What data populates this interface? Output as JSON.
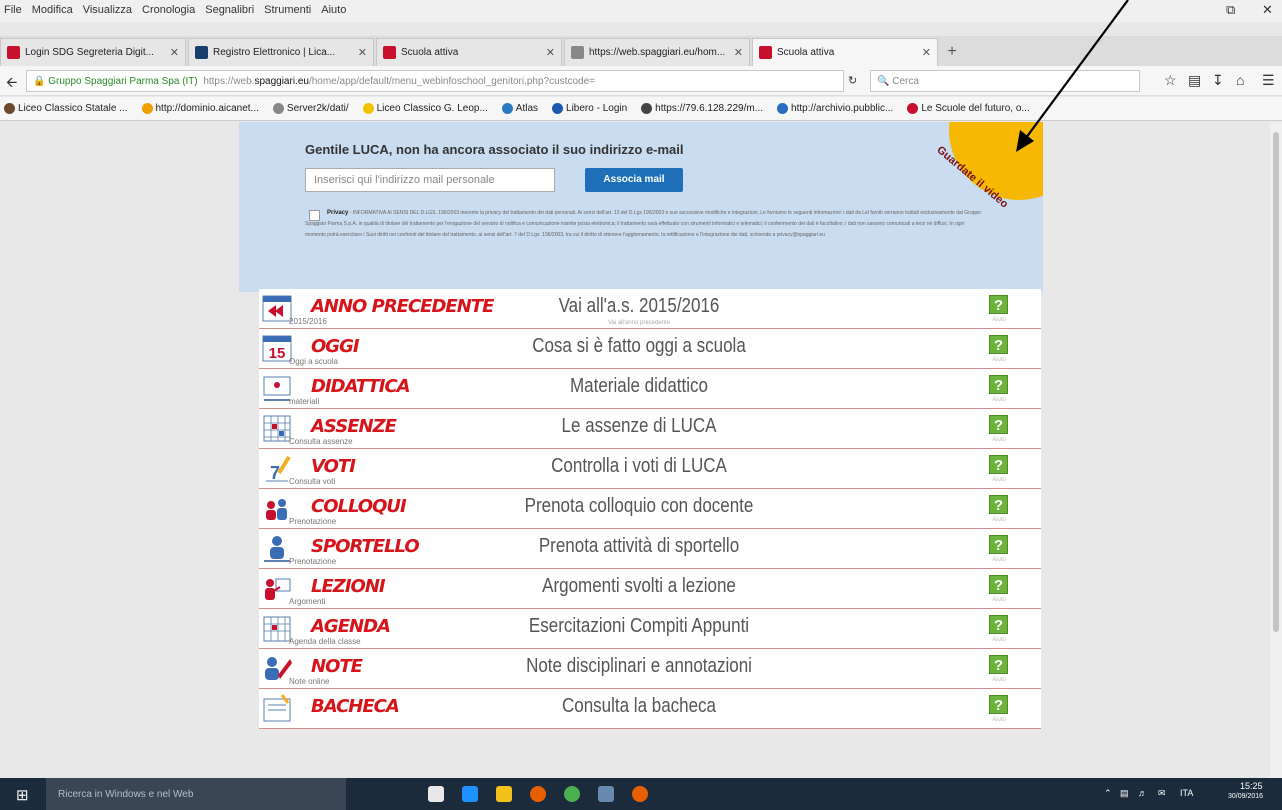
{
  "window_menu": [
    "File",
    "Modifica",
    "Visualizza",
    "Cronologia",
    "Segnalibri",
    "Strumenti",
    "Aiuto"
  ],
  "tabs": [
    {
      "label": "Login SDG Segreteria Digit...",
      "color": "#c8102e"
    },
    {
      "label": "Registro Elettronico | Lica...",
      "color": "#1a3c6e"
    },
    {
      "label": "Scuola attiva",
      "color": "#c8102e"
    },
    {
      "label": "https://web.spaggiari.eu/hom...",
      "color": "#888888"
    },
    {
      "label": "Scuola attiva",
      "color": "#c8102e"
    }
  ],
  "address": {
    "site": "Gruppo Spaggiari Parma Spa (IT)",
    "prefix": "https://web.",
    "domain": "spaggiari.eu",
    "path": "/home/app/default/menu_webinfoschool_genitori.php?custcode="
  },
  "search": {
    "placeholder": "Cerca"
  },
  "bookmarks": [
    {
      "label": "Liceo Classico Statale ...",
      "color": "#6a4a2a"
    },
    {
      "label": "http://dominio.aicanet...",
      "color": "#f0a000"
    },
    {
      "label": "Server2k/dati/",
      "color": "#888888"
    },
    {
      "label": "Liceo Classico G. Leop...",
      "color": "#f2c200"
    },
    {
      "label": "Atlas",
      "color": "#2a7ac0"
    },
    {
      "label": "Libero - Login",
      "color": "#1a5ab0"
    },
    {
      "label": "https://79.6.128.229/m...",
      "color": "#444444"
    },
    {
      "label": "http://archivio.pubblic...",
      "color": "#2a6ac0"
    },
    {
      "label": "Le Scuole del futuro, o...",
      "color": "#c8102e"
    }
  ],
  "panel": {
    "title": "Gentile LUCA, non ha ancora associato il suo indirizzo e-mail",
    "email_placeholder": "Inserisci qui l'indirizzo mail personale",
    "button_label": "Associa mail",
    "privacy_label": "Privacy",
    "privacy_text": "- INFORMATIVA AI SENSI DEL D.LGS. 196/2003 inerente la privacy del trattamento dei dati personali. Ai sensi dell'art. 13 del D.Lgs 196/2003 e sue successive modifiche e integrazioni, Le forniamo le seguenti informazioni: i dati da Lei forniti verranno trattati esclusivamente dal Gruppo Spaggiari Parma S.p.A. in qualità di titolare del trattamento per l'erogazione del servizio di notifica e comunicazione tramite posta elettronica; il trattamento sarà effettuato con strumenti informatici e telematici; il conferimento dei dati è facoltativo; i dati non saranno comunicati a terzi né diffusi. In ogni momento potrà esercitare i Suoi diritti nei confronti del titolare del trattamento, ai sensi dell'art. 7 del D.Lgs. 196/2003, tra cui il diritto di ottenere l'aggiornamento, la rettificazione e l'integrazione dei dati, scrivendo a privacy@spaggiari.eu",
    "video_badge": "Guardate il video"
  },
  "menu": [
    {
      "title": "ANNO PRECEDENTE",
      "sub": "2015/2016",
      "desc": "Vai all'a.s. 2015/2016",
      "desc_sub": "Vai all'anno precedente",
      "icon": "calendar-back-icon"
    },
    {
      "title": "OGGI",
      "sub": "Oggi a scuola",
      "desc": "Cosa si è fatto oggi a scuola",
      "desc_sub": "",
      "icon": "calendar-15-icon"
    },
    {
      "title": "DIDATTICA",
      "sub": "materiali",
      "desc": "Materiale didattico",
      "desc_sub": "",
      "icon": "blackboard-icon"
    },
    {
      "title": "ASSENZE",
      "sub": "Consulta assenze",
      "desc": "Le assenze di LUCA",
      "desc_sub": "",
      "icon": "grid-calendar-icon"
    },
    {
      "title": "VOTI",
      "sub": "Consulta voti",
      "desc": "Controlla i voti di LUCA",
      "desc_sub": "",
      "icon": "grade-pencil-icon"
    },
    {
      "title": "COLLOQUI",
      "sub": "Prenotazione",
      "desc": "Prenota colloquio con docente",
      "desc_sub": "",
      "icon": "meeting-people-icon"
    },
    {
      "title": "SPORTELLO",
      "sub": "Prenotazione",
      "desc": "Prenota attività di sportello",
      "desc_sub": "",
      "icon": "person-desk-icon"
    },
    {
      "title": "LEZIONI",
      "sub": "Argomenti",
      "desc": "Argomenti svolti a lezione",
      "desc_sub": "",
      "icon": "teacher-board-icon"
    },
    {
      "title": "AGENDA",
      "sub": "Agenda della classe",
      "desc": "Esercitazioni Compiti Appunti",
      "desc_sub": "",
      "icon": "agenda-calendar-icon"
    },
    {
      "title": "NOTE",
      "sub": "Note online",
      "desc": "Note disciplinari e annotazioni",
      "desc_sub": "",
      "icon": "note-person-icon"
    },
    {
      "title": "BACHECA",
      "sub": "",
      "desc": "Consulta la bacheca",
      "desc_sub": "",
      "icon": "bulletin-board-icon"
    }
  ],
  "help": {
    "symbol": "?",
    "label": "Aiuto"
  },
  "taskbar": {
    "search_placeholder": "Ricerca in Windows e nel Web",
    "time": "15:25",
    "date": "30/09/2016",
    "lang": "ITA"
  }
}
